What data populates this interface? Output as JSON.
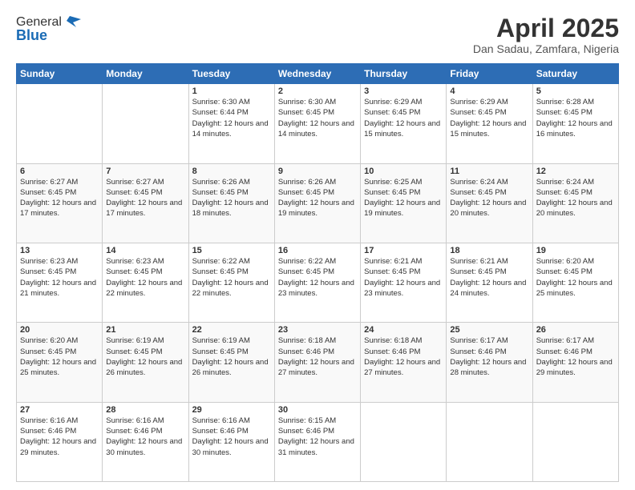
{
  "logo": {
    "general": "General",
    "blue": "Blue"
  },
  "title": "April 2025",
  "subtitle": "Dan Sadau, Zamfara, Nigeria",
  "days_of_week": [
    "Sunday",
    "Monday",
    "Tuesday",
    "Wednesday",
    "Thursday",
    "Friday",
    "Saturday"
  ],
  "weeks": [
    [
      {
        "day": "",
        "sunrise": "",
        "sunset": "",
        "daylight": ""
      },
      {
        "day": "",
        "sunrise": "",
        "sunset": "",
        "daylight": ""
      },
      {
        "day": "1",
        "sunrise": "Sunrise: 6:30 AM",
        "sunset": "Sunset: 6:44 PM",
        "daylight": "Daylight: 12 hours and 14 minutes."
      },
      {
        "day": "2",
        "sunrise": "Sunrise: 6:30 AM",
        "sunset": "Sunset: 6:45 PM",
        "daylight": "Daylight: 12 hours and 14 minutes."
      },
      {
        "day": "3",
        "sunrise": "Sunrise: 6:29 AM",
        "sunset": "Sunset: 6:45 PM",
        "daylight": "Daylight: 12 hours and 15 minutes."
      },
      {
        "day": "4",
        "sunrise": "Sunrise: 6:29 AM",
        "sunset": "Sunset: 6:45 PM",
        "daylight": "Daylight: 12 hours and 15 minutes."
      },
      {
        "day": "5",
        "sunrise": "Sunrise: 6:28 AM",
        "sunset": "Sunset: 6:45 PM",
        "daylight": "Daylight: 12 hours and 16 minutes."
      }
    ],
    [
      {
        "day": "6",
        "sunrise": "Sunrise: 6:27 AM",
        "sunset": "Sunset: 6:45 PM",
        "daylight": "Daylight: 12 hours and 17 minutes."
      },
      {
        "day": "7",
        "sunrise": "Sunrise: 6:27 AM",
        "sunset": "Sunset: 6:45 PM",
        "daylight": "Daylight: 12 hours and 17 minutes."
      },
      {
        "day": "8",
        "sunrise": "Sunrise: 6:26 AM",
        "sunset": "Sunset: 6:45 PM",
        "daylight": "Daylight: 12 hours and 18 minutes."
      },
      {
        "day": "9",
        "sunrise": "Sunrise: 6:26 AM",
        "sunset": "Sunset: 6:45 PM",
        "daylight": "Daylight: 12 hours and 19 minutes."
      },
      {
        "day": "10",
        "sunrise": "Sunrise: 6:25 AM",
        "sunset": "Sunset: 6:45 PM",
        "daylight": "Daylight: 12 hours and 19 minutes."
      },
      {
        "day": "11",
        "sunrise": "Sunrise: 6:24 AM",
        "sunset": "Sunset: 6:45 PM",
        "daylight": "Daylight: 12 hours and 20 minutes."
      },
      {
        "day": "12",
        "sunrise": "Sunrise: 6:24 AM",
        "sunset": "Sunset: 6:45 PM",
        "daylight": "Daylight: 12 hours and 20 minutes."
      }
    ],
    [
      {
        "day": "13",
        "sunrise": "Sunrise: 6:23 AM",
        "sunset": "Sunset: 6:45 PM",
        "daylight": "Daylight: 12 hours and 21 minutes."
      },
      {
        "day": "14",
        "sunrise": "Sunrise: 6:23 AM",
        "sunset": "Sunset: 6:45 PM",
        "daylight": "Daylight: 12 hours and 22 minutes."
      },
      {
        "day": "15",
        "sunrise": "Sunrise: 6:22 AM",
        "sunset": "Sunset: 6:45 PM",
        "daylight": "Daylight: 12 hours and 22 minutes."
      },
      {
        "day": "16",
        "sunrise": "Sunrise: 6:22 AM",
        "sunset": "Sunset: 6:45 PM",
        "daylight": "Daylight: 12 hours and 23 minutes."
      },
      {
        "day": "17",
        "sunrise": "Sunrise: 6:21 AM",
        "sunset": "Sunset: 6:45 PM",
        "daylight": "Daylight: 12 hours and 23 minutes."
      },
      {
        "day": "18",
        "sunrise": "Sunrise: 6:21 AM",
        "sunset": "Sunset: 6:45 PM",
        "daylight": "Daylight: 12 hours and 24 minutes."
      },
      {
        "day": "19",
        "sunrise": "Sunrise: 6:20 AM",
        "sunset": "Sunset: 6:45 PM",
        "daylight": "Daylight: 12 hours and 25 minutes."
      }
    ],
    [
      {
        "day": "20",
        "sunrise": "Sunrise: 6:20 AM",
        "sunset": "Sunset: 6:45 PM",
        "daylight": "Daylight: 12 hours and 25 minutes."
      },
      {
        "day": "21",
        "sunrise": "Sunrise: 6:19 AM",
        "sunset": "Sunset: 6:45 PM",
        "daylight": "Daylight: 12 hours and 26 minutes."
      },
      {
        "day": "22",
        "sunrise": "Sunrise: 6:19 AM",
        "sunset": "Sunset: 6:45 PM",
        "daylight": "Daylight: 12 hours and 26 minutes."
      },
      {
        "day": "23",
        "sunrise": "Sunrise: 6:18 AM",
        "sunset": "Sunset: 6:46 PM",
        "daylight": "Daylight: 12 hours and 27 minutes."
      },
      {
        "day": "24",
        "sunrise": "Sunrise: 6:18 AM",
        "sunset": "Sunset: 6:46 PM",
        "daylight": "Daylight: 12 hours and 27 minutes."
      },
      {
        "day": "25",
        "sunrise": "Sunrise: 6:17 AM",
        "sunset": "Sunset: 6:46 PM",
        "daylight": "Daylight: 12 hours and 28 minutes."
      },
      {
        "day": "26",
        "sunrise": "Sunrise: 6:17 AM",
        "sunset": "Sunset: 6:46 PM",
        "daylight": "Daylight: 12 hours and 29 minutes."
      }
    ],
    [
      {
        "day": "27",
        "sunrise": "Sunrise: 6:16 AM",
        "sunset": "Sunset: 6:46 PM",
        "daylight": "Daylight: 12 hours and 29 minutes."
      },
      {
        "day": "28",
        "sunrise": "Sunrise: 6:16 AM",
        "sunset": "Sunset: 6:46 PM",
        "daylight": "Daylight: 12 hours and 30 minutes."
      },
      {
        "day": "29",
        "sunrise": "Sunrise: 6:16 AM",
        "sunset": "Sunset: 6:46 PM",
        "daylight": "Daylight: 12 hours and 30 minutes."
      },
      {
        "day": "30",
        "sunrise": "Sunrise: 6:15 AM",
        "sunset": "Sunset: 6:46 PM",
        "daylight": "Daylight: 12 hours and 31 minutes."
      },
      {
        "day": "",
        "sunrise": "",
        "sunset": "",
        "daylight": ""
      },
      {
        "day": "",
        "sunrise": "",
        "sunset": "",
        "daylight": ""
      },
      {
        "day": "",
        "sunrise": "",
        "sunset": "",
        "daylight": ""
      }
    ]
  ]
}
